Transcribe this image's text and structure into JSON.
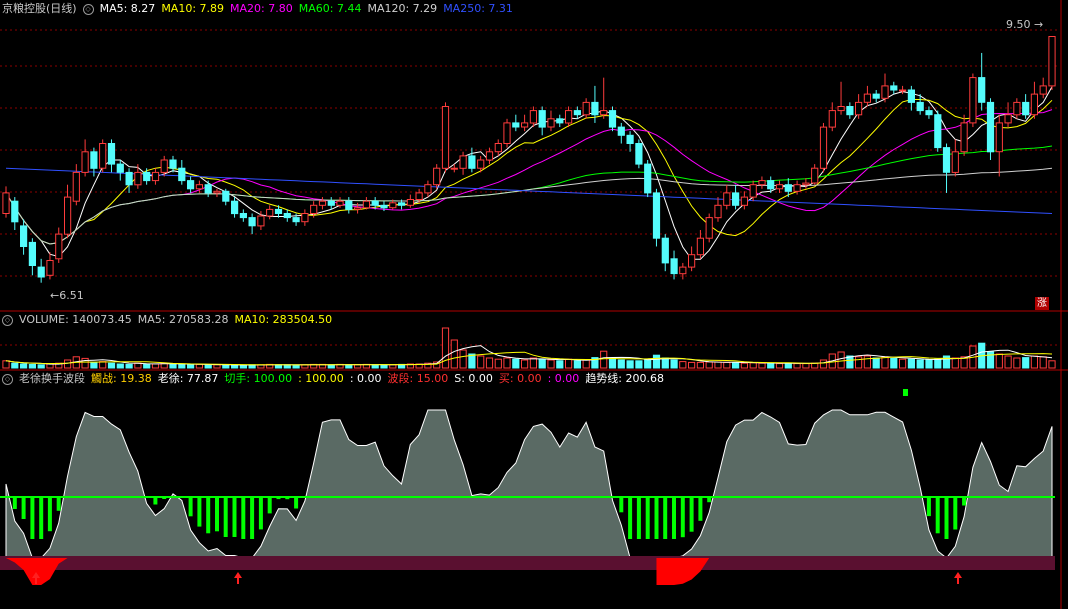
{
  "header": {
    "stock_name": "京粮控股(日线)",
    "ma": [
      {
        "label": "MA5: 8.27",
        "color": "#ffffff"
      },
      {
        "label": "MA10: 7.89",
        "color": "#ffff00"
      },
      {
        "label": "MA20: 7.80",
        "color": "#ff00ff"
      },
      {
        "label": "MA60: 7.44",
        "color": "#00ff00"
      },
      {
        "label": "MA120: 7.29",
        "color": "#d0d0d0"
      },
      {
        "label": "MA250: 7.31",
        "color": "#3050ff"
      }
    ]
  },
  "volume_header": {
    "title": "VOLUME: 140073.45",
    "ma5": "MA5: 270583.28",
    "ma10": "MA10: 283504.50"
  },
  "indicator_header": {
    "title": "老徐换手波段",
    "items": [
      {
        "label": "觸战: 19.38",
        "color": "#ffd000"
      },
      {
        "label": "老徐: 77.87",
        "color": "#ffffff"
      },
      {
        "label": "切手: 100.00",
        "color": "#00ff00"
      },
      {
        "label": ": 100.00",
        "color": "#ffff00"
      },
      {
        "label": ": 0.00",
        "color": "#ffffff"
      },
      {
        "label": "波段: 15.00",
        "color": "#ff3030"
      },
      {
        "label": "S: 0.00",
        "color": "#ffffff"
      },
      {
        "label": "买: 0.00",
        "color": "#ff3030"
      },
      {
        "label": ": 0.00",
        "color": "#ff00ff"
      },
      {
        "label": "趋势线: 200.68",
        "color": "#ffffff"
      }
    ]
  },
  "price_labels": {
    "high": "9.50",
    "low": "6.51",
    "badge": "涨"
  },
  "colors": {
    "up": "#ff3c3c",
    "down": "#54fcfc",
    "grid": "#8b0000",
    "panel_border": "#b00000"
  },
  "chart_data": {
    "type": "candlestick",
    "ylim": [
      6.3,
      9.7
    ],
    "candles": [
      [
        7.35,
        7.6,
        7.68,
        7.3
      ],
      [
        7.5,
        7.25,
        7.55,
        7.15
      ],
      [
        7.2,
        6.95,
        7.28,
        6.85
      ],
      [
        7.0,
        6.72,
        7.05,
        6.6
      ],
      [
        6.7,
        6.58,
        6.8,
        6.51
      ],
      [
        6.6,
        6.78,
        6.88,
        6.55
      ],
      [
        6.8,
        7.1,
        7.18,
        6.75
      ],
      [
        7.1,
        7.55,
        7.7,
        7.05
      ],
      [
        7.5,
        7.85,
        7.95,
        7.45
      ],
      [
        7.85,
        8.1,
        8.25,
        7.8
      ],
      [
        8.1,
        7.9,
        8.15,
        7.8
      ],
      [
        7.9,
        8.2,
        8.25,
        7.85
      ],
      [
        8.2,
        7.95,
        8.25,
        7.85
      ],
      [
        7.95,
        7.85,
        8.0,
        7.75
      ],
      [
        7.85,
        7.7,
        7.9,
        7.6
      ],
      [
        7.7,
        7.85,
        7.95,
        7.65
      ],
      [
        7.85,
        7.75,
        7.9,
        7.7
      ],
      [
        7.75,
        7.85,
        7.9,
        7.7
      ],
      [
        7.85,
        8.0,
        8.05,
        7.8
      ],
      [
        8.0,
        7.9,
        8.05,
        7.85
      ],
      [
        7.9,
        7.75,
        8.0,
        7.7
      ],
      [
        7.75,
        7.65,
        7.8,
        7.6
      ],
      [
        7.65,
        7.7,
        7.75,
        7.6
      ],
      [
        7.7,
        7.6,
        7.75,
        7.55
      ],
      [
        7.6,
        7.62,
        7.65,
        7.55
      ],
      [
        7.62,
        7.5,
        7.65,
        7.45
      ],
      [
        7.5,
        7.35,
        7.55,
        7.3
      ],
      [
        7.35,
        7.3,
        7.4,
        7.25
      ],
      [
        7.3,
        7.2,
        7.35,
        7.1
      ],
      [
        7.2,
        7.32,
        7.38,
        7.15
      ],
      [
        7.32,
        7.4,
        7.45,
        7.28
      ],
      [
        7.4,
        7.35,
        7.45,
        7.3
      ],
      [
        7.35,
        7.3,
        7.4,
        7.25
      ],
      [
        7.3,
        7.25,
        7.35,
        7.2
      ],
      [
        7.25,
        7.35,
        7.4,
        7.2
      ],
      [
        7.35,
        7.45,
        7.5,
        7.3
      ],
      [
        7.45,
        7.5,
        7.55,
        7.4
      ],
      [
        7.5,
        7.45,
        7.55,
        7.4
      ],
      [
        7.45,
        7.5,
        7.55,
        7.42
      ],
      [
        7.5,
        7.4,
        7.55,
        7.35
      ],
      [
        7.4,
        7.42,
        7.48,
        7.35
      ],
      [
        7.42,
        7.5,
        7.55,
        7.4
      ],
      [
        7.5,
        7.45,
        7.55,
        7.4
      ],
      [
        7.45,
        7.42,
        7.5,
        7.38
      ],
      [
        7.42,
        7.48,
        7.52,
        7.4
      ],
      [
        7.48,
        7.45,
        7.52,
        7.4
      ],
      [
        7.45,
        7.52,
        7.58,
        7.42
      ],
      [
        7.52,
        7.6,
        7.65,
        7.48
      ],
      [
        7.6,
        7.7,
        7.75,
        7.55
      ],
      [
        7.7,
        7.9,
        7.95,
        7.65
      ],
      [
        7.9,
        8.65,
        8.7,
        7.85
      ],
      [
        7.9,
        7.9,
        7.95,
        7.85
      ],
      [
        7.9,
        8.05,
        8.1,
        7.82
      ],
      [
        8.05,
        7.9,
        8.15,
        7.85
      ],
      [
        7.9,
        8.0,
        8.05,
        7.85
      ],
      [
        8.0,
        8.1,
        8.15,
        7.95
      ],
      [
        8.1,
        8.2,
        8.25,
        8.05
      ],
      [
        8.2,
        8.45,
        8.5,
        8.15
      ],
      [
        8.45,
        8.4,
        8.55,
        8.35
      ],
      [
        8.4,
        8.45,
        8.55,
        8.35
      ],
      [
        8.45,
        8.6,
        8.65,
        8.4
      ],
      [
        8.6,
        8.4,
        8.65,
        8.3
      ],
      [
        8.4,
        8.5,
        8.6,
        8.35
      ],
      [
        8.5,
        8.45,
        8.55,
        8.4
      ],
      [
        8.45,
        8.6,
        8.65,
        8.4
      ],
      [
        8.6,
        8.55,
        8.65,
        8.5
      ],
      [
        8.55,
        8.7,
        8.75,
        8.5
      ],
      [
        8.7,
        8.55,
        8.9,
        8.45
      ],
      [
        8.55,
        8.6,
        9.0,
        8.5
      ],
      [
        8.6,
        8.4,
        8.65,
        8.35
      ],
      [
        8.4,
        8.3,
        8.45,
        8.2
      ],
      [
        8.3,
        8.2,
        8.35,
        8.1
      ],
      [
        8.2,
        7.95,
        8.25,
        7.9
      ],
      [
        7.95,
        7.6,
        8.0,
        7.55
      ],
      [
        7.6,
        7.05,
        7.65,
        6.95
      ],
      [
        7.05,
        6.75,
        7.1,
        6.65
      ],
      [
        6.8,
        6.62,
        6.9,
        6.55
      ],
      [
        6.62,
        6.7,
        6.75,
        6.55
      ],
      [
        6.7,
        6.85,
        6.95,
        6.65
      ],
      [
        6.85,
        7.05,
        7.15,
        6.8
      ],
      [
        7.05,
        7.3,
        7.35,
        7.0
      ],
      [
        7.3,
        7.45,
        7.55,
        7.25
      ],
      [
        7.45,
        7.6,
        7.7,
        7.4
      ],
      [
        7.6,
        7.45,
        7.7,
        7.4
      ],
      [
        7.45,
        7.55,
        7.62,
        7.4
      ],
      [
        7.55,
        7.7,
        7.75,
        7.5
      ],
      [
        7.7,
        7.75,
        7.8,
        7.65
      ],
      [
        7.75,
        7.65,
        7.8,
        7.6
      ],
      [
        7.65,
        7.7,
        7.75,
        7.6
      ],
      [
        7.7,
        7.62,
        7.78,
        7.55
      ],
      [
        7.62,
        7.7,
        7.75,
        7.58
      ],
      [
        7.7,
        7.72,
        7.78,
        7.65
      ],
      [
        7.72,
        7.9,
        7.95,
        7.7
      ],
      [
        7.9,
        8.4,
        8.45,
        7.85
      ],
      [
        8.4,
        8.6,
        8.7,
        8.35
      ],
      [
        8.6,
        8.65,
        8.95,
        8.55
      ],
      [
        8.65,
        8.55,
        8.7,
        8.5
      ],
      [
        8.55,
        8.7,
        8.8,
        8.5
      ],
      [
        8.7,
        8.8,
        8.9,
        8.65
      ],
      [
        8.8,
        8.75,
        8.85,
        8.7
      ],
      [
        8.75,
        8.9,
        9.05,
        8.7
      ],
      [
        8.9,
        8.85,
        8.95,
        8.8
      ],
      [
        8.85,
        8.85,
        8.9,
        8.8
      ],
      [
        8.85,
        8.7,
        8.9,
        8.6
      ],
      [
        8.7,
        8.6,
        8.8,
        8.55
      ],
      [
        8.6,
        8.55,
        8.65,
        8.5
      ],
      [
        8.55,
        8.15,
        8.6,
        8.1
      ],
      [
        8.15,
        7.85,
        8.2,
        7.6
      ],
      [
        7.85,
        8.1,
        8.25,
        7.8
      ],
      [
        8.1,
        8.45,
        8.55,
        8.05
      ],
      [
        8.45,
        9.0,
        9.05,
        8.4
      ],
      [
        9.0,
        8.7,
        9.3,
        8.6
      ],
      [
        8.7,
        8.1,
        8.75,
        8.0
      ],
      [
        8.1,
        8.45,
        8.55,
        7.8
      ],
      [
        8.45,
        8.55,
        8.7,
        8.4
      ],
      [
        8.55,
        8.7,
        8.75,
        8.5
      ],
      [
        8.7,
        8.55,
        8.8,
        8.5
      ],
      [
        8.55,
        8.8,
        8.95,
        8.5
      ],
      [
        8.8,
        8.9,
        9.0,
        8.75
      ],
      [
        8.9,
        9.5,
        9.5,
        8.85
      ]
    ],
    "volume": [
      0.18,
      0.12,
      0.1,
      0.09,
      0.08,
      0.1,
      0.12,
      0.2,
      0.28,
      0.24,
      0.14,
      0.16,
      0.12,
      0.1,
      0.09,
      0.12,
      0.1,
      0.1,
      0.12,
      0.1,
      0.09,
      0.08,
      0.09,
      0.08,
      0.08,
      0.07,
      0.07,
      0.07,
      0.08,
      0.08,
      0.09,
      0.08,
      0.08,
      0.07,
      0.08,
      0.09,
      0.09,
      0.08,
      0.09,
      0.08,
      0.08,
      0.09,
      0.08,
      0.08,
      0.08,
      0.09,
      0.1,
      0.1,
      0.12,
      0.15,
      1.0,
      0.7,
      0.45,
      0.35,
      0.3,
      0.25,
      0.22,
      0.25,
      0.22,
      0.2,
      0.25,
      0.22,
      0.2,
      0.18,
      0.22,
      0.18,
      0.2,
      0.26,
      0.42,
      0.25,
      0.2,
      0.18,
      0.18,
      0.22,
      0.32,
      0.25,
      0.2,
      0.16,
      0.14,
      0.14,
      0.15,
      0.15,
      0.14,
      0.13,
      0.12,
      0.13,
      0.12,
      0.12,
      0.11,
      0.12,
      0.11,
      0.11,
      0.12,
      0.2,
      0.35,
      0.4,
      0.3,
      0.28,
      0.3,
      0.25,
      0.28,
      0.24,
      0.22,
      0.22,
      0.2,
      0.2,
      0.22,
      0.3,
      0.25,
      0.28,
      0.55,
      0.62,
      0.4,
      0.35,
      0.3,
      0.25,
      0.26,
      0.3,
      0.28,
      0.18
    ]
  }
}
